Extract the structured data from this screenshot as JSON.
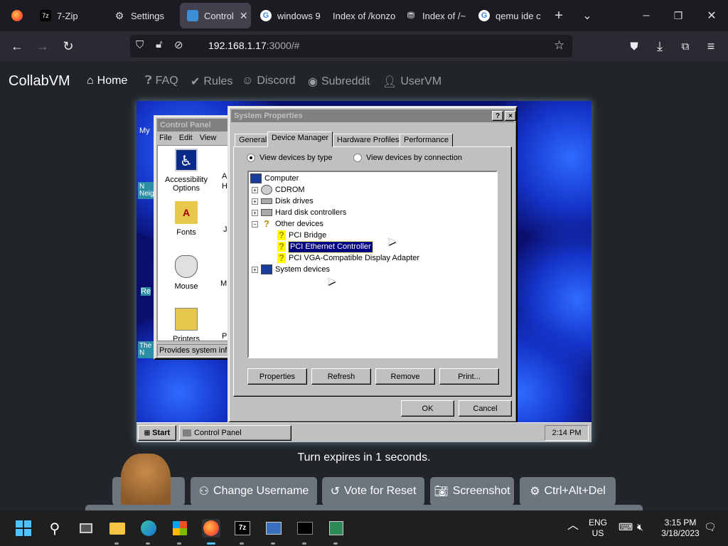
{
  "browser": {
    "tabs": [
      {
        "label": "7-Zip",
        "icon": "7zip-icon"
      },
      {
        "label": "Settings",
        "icon": "gear-icon"
      },
      {
        "label": "Control",
        "icon": "monitor-icon",
        "active": true
      },
      {
        "label": "windows 9",
        "icon": "google-icon"
      },
      {
        "label": "Index of /konzo",
        "icon": "none"
      },
      {
        "label": "Index of /~",
        "icon": "server-icon"
      },
      {
        "label": "qemu ide c",
        "icon": "google-icon"
      }
    ],
    "url": "192.168.1.17",
    "url_rest": ":3000/#"
  },
  "site": {
    "brand": "CollabVM",
    "nav": [
      {
        "label": "Home",
        "icon": "home-icon",
        "active": true
      },
      {
        "label": "FAQ",
        "icon": "question-icon"
      },
      {
        "label": "Rules",
        "icon": "clipboard-check-icon"
      },
      {
        "label": "Discord",
        "icon": "discord-icon"
      },
      {
        "label": "Subreddit",
        "icon": "reddit-icon"
      },
      {
        "label": "UserVM",
        "icon": "user-icon"
      }
    ],
    "turn_text": "Turn expires in 1 seconds.",
    "controls": [
      {
        "label": "rn",
        "icon": "hand-icon"
      },
      {
        "label": "Change Username",
        "icon": "users-icon"
      },
      {
        "label": "Vote for Reset",
        "icon": "undo-icon"
      },
      {
        "label": "Screenshot",
        "icon": "camera-icon"
      },
      {
        "label": "Ctrl+Alt+Del",
        "icon": "gear-icon"
      }
    ]
  },
  "vm": {
    "desktop_labels": [
      "My",
      "N",
      "Neig",
      "Re",
      "The",
      "N"
    ],
    "control_panel": {
      "title": "Control Panel",
      "menu": [
        "File",
        "Edit",
        "View"
      ],
      "icons": [
        "Accessibility Options",
        "Fonts",
        "Mouse",
        "Printers"
      ],
      "partial_labels": [
        "A",
        "H",
        "J",
        "M",
        "P"
      ],
      "status": "Provides system info"
    },
    "system_properties": {
      "title": "System Properties",
      "tabs": [
        "General",
        "Device Manager",
        "Hardware Profiles",
        "Performance"
      ],
      "selected_tab": "Device Manager",
      "radio_by_type": "View devices by type",
      "radio_by_connection": "View devices by connection",
      "tree": [
        {
          "label": "Computer",
          "level": 0
        },
        {
          "label": "CDROM",
          "level": 1,
          "expander": "+"
        },
        {
          "label": "Disk drives",
          "level": 1,
          "expander": "+"
        },
        {
          "label": "Hard disk controllers",
          "level": 1,
          "expander": "+"
        },
        {
          "label": "Other devices",
          "level": 1,
          "expander": "-"
        },
        {
          "label": "PCI Bridge",
          "level": 2
        },
        {
          "label": "PCI Ethernet Controller",
          "level": 2,
          "selected": true
        },
        {
          "label": "PCI VGA-Compatible Display Adapter",
          "level": 2
        },
        {
          "label": "System devices",
          "level": 1,
          "expander": "+"
        }
      ],
      "buttons": [
        "Properties",
        "Refresh",
        "Remove",
        "Print..."
      ],
      "ok": "OK",
      "cancel": "Cancel",
      "help_btn": "?",
      "close_btn": "×"
    },
    "taskbar": {
      "start": "Start",
      "task": "Control Panel",
      "clock": "2:14 PM"
    }
  },
  "os_taskbar": {
    "lang": "ENG",
    "region": "US",
    "time": "3:15 PM",
    "date": "3/18/2023"
  },
  "colors": {
    "browser_bg": "#1c1b22",
    "page_bg": "#212529",
    "button_bg": "#6c757d",
    "win95_face": "#c0c0c0",
    "win95_select": "#000080"
  }
}
